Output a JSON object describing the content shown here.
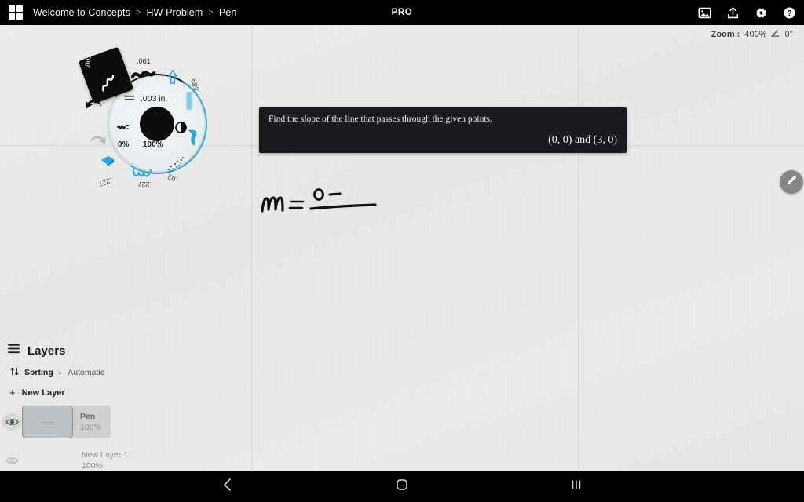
{
  "topbar": {
    "menu_icon": "grid-menu-icon",
    "breadcrumb": [
      "Welcome to Concepts",
      "HW Problem",
      "Pen"
    ],
    "separator": ">",
    "pro_badge": "PRO",
    "actions": [
      {
        "name": "gallery-icon",
        "label": "Gallery"
      },
      {
        "name": "export-icon",
        "label": "Export"
      },
      {
        "name": "settings-gear-icon",
        "label": "Settings"
      },
      {
        "name": "help-icon",
        "label": "Help"
      }
    ]
  },
  "canvas": {
    "zoom": {
      "label": "Zoom :",
      "value": "400%",
      "angle_icon": "angle-icon",
      "angle": "0°"
    },
    "problem_card": {
      "statement": "Find the slope of the line that passes through the given points.",
      "points": "(0, 0) and (3, 0)"
    },
    "handwriting": {
      "expression": "m = 0 −",
      "alt": "handwritten: m equals 0 minus, with fraction bar"
    },
    "edit_tab_icon": "pencil-icon"
  },
  "tool_wheel": {
    "selected_brush_size": ".003",
    "center_size": ".003 in",
    "center_size_icon": "stroke-weight-icon",
    "opacity_min": "0%",
    "opacity_max": "100%",
    "smoothing_icon": "smoothing-icon",
    "opacity_icon": "opacity-icon",
    "presets": [
      {
        "name": "preset-061",
        "label": ".061"
      },
      {
        "name": "preset-689",
        "label": ".689"
      },
      {
        "name": "preset-02",
        "label": ".02"
      },
      {
        "name": "preset-227-wave",
        "label": ".227"
      },
      {
        "name": "preset-227-marker",
        "label": ".227"
      }
    ],
    "undo_icon": "undo-arrow-icon",
    "redo_icon": "redo-arrow-icon",
    "accent_color": "#2fa8d8"
  },
  "layers": {
    "menu_icon": "layers-menu-icon",
    "title": "Layers",
    "sorting": {
      "icon": "sort-icon",
      "label": "Sorting",
      "separator": "▸",
      "value": "Automatic"
    },
    "new_layer": {
      "plus": "+",
      "label": "New Layer"
    },
    "items": [
      {
        "name": "Pen",
        "opacity": "100%",
        "visible": true,
        "selected": true
      },
      {
        "name": "New Layer 1",
        "opacity": "100%",
        "visible": false,
        "selected": false
      }
    ]
  },
  "navbar": {
    "buttons": [
      {
        "name": "nav-back-button",
        "icon": "chevron-left-icon"
      },
      {
        "name": "nav-home-button",
        "icon": "home-square-icon"
      },
      {
        "name": "nav-recents-button",
        "icon": "recents-bars-icon"
      }
    ]
  },
  "colors": {
    "accent": "#2fa8d8",
    "topbar_bg": "#000000",
    "canvas_bg": "#e8e9e9",
    "card_bg": "#191b1f"
  }
}
